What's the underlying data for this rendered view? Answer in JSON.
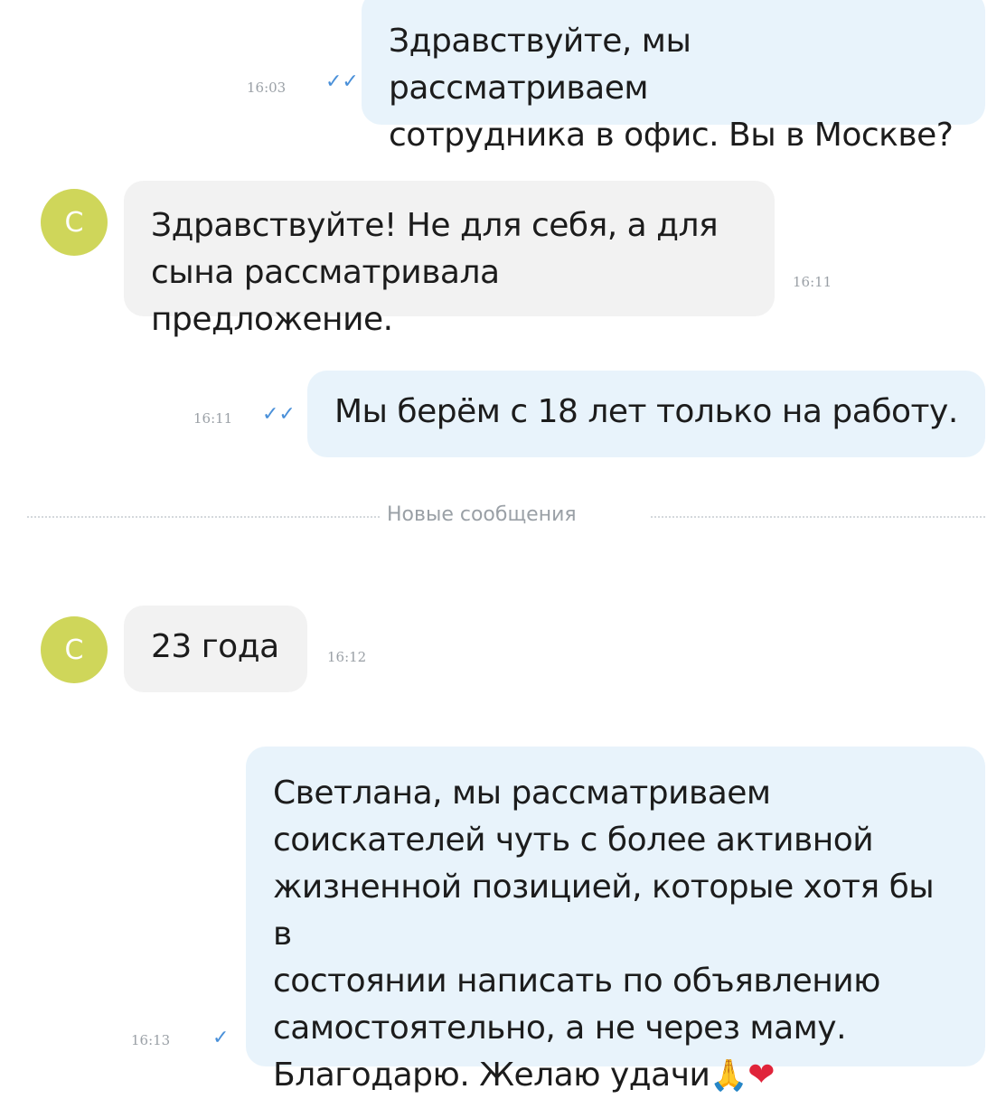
{
  "messages": [
    {
      "direction": "out",
      "line1": "Здравствуйте, мы рассматриваем",
      "line2": "сотрудника в офис. Вы в Москве?",
      "time": "16:03",
      "status_icon": "double-check-icon"
    },
    {
      "direction": "in",
      "avatar": "С",
      "line1": "Здравствуйте! Не для себя, а для",
      "line2": "сына рассматривала предложение.",
      "time": "16:11"
    },
    {
      "direction": "out",
      "line1": "Мы берём с 18 лет только на работу.",
      "time": "16:11",
      "status_icon": "double-check-icon"
    },
    {
      "direction": "in",
      "avatar": "С",
      "line1": "23 года",
      "time": "16:12"
    },
    {
      "direction": "out",
      "lines": [
        "Светлана, мы рассматриваем",
        "соискателей чуть с более активной",
        "жизненной позицией, которые хотя бы в",
        "состоянии написать по объявлению",
        "самостоятельно, а не через маму.",
        "Благодарю. Желаю удачи"
      ],
      "emoji_pray": "🙏",
      "emoji_heart": "❤",
      "time": "16:13",
      "status_icon": "single-check-icon"
    }
  ],
  "divider": {
    "label": "Новые сообщения"
  },
  "colors": {
    "outgoing": "#e8f3fb",
    "incoming": "#f2f2f2",
    "avatar": "#cfd65a",
    "check": "#4a90d9",
    "time": "#9aa0a6"
  }
}
